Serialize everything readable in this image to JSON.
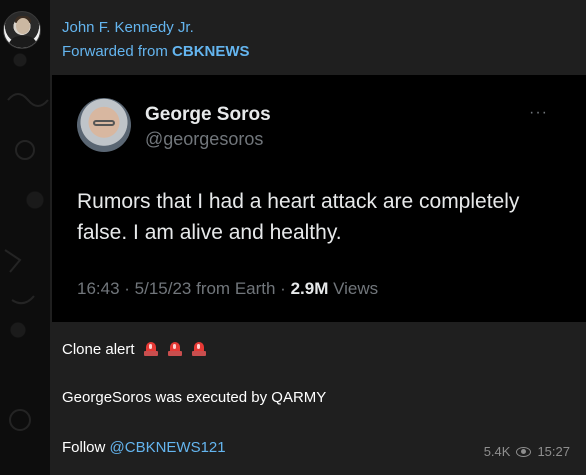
{
  "post": {
    "sender_name": "John F. Kennedy Jr.",
    "forwarded_prefix": "Forwarded from",
    "forwarded_source": "CBKNEWS",
    "views": "5.4K",
    "time": "15:27"
  },
  "tweet": {
    "name": "George Soros",
    "handle": "@georgesoros",
    "more": "···",
    "text": "Rumors that I had a heart attack are completely false. I am alive and healthy.",
    "meta_prefix": "16:43 · 5/15/23 from Earth · ",
    "views_count": "2.9M",
    "views_label": " Views"
  },
  "message": {
    "line1": "Clone alert",
    "line2": "GeorgeSoros was executed by QARMY",
    "line3_prefix": "Follow ",
    "line3_link": "@CBKNEWS121"
  },
  "icons": {
    "avatar": "avatar-photo",
    "tweet_avatar": "profile-photo",
    "siren": "rotating-light-icon",
    "views": "eye-icon"
  },
  "colors": {
    "accent": "#64b5ef",
    "bubble": "#1f1f1f",
    "tweet_bg": "#000000"
  }
}
